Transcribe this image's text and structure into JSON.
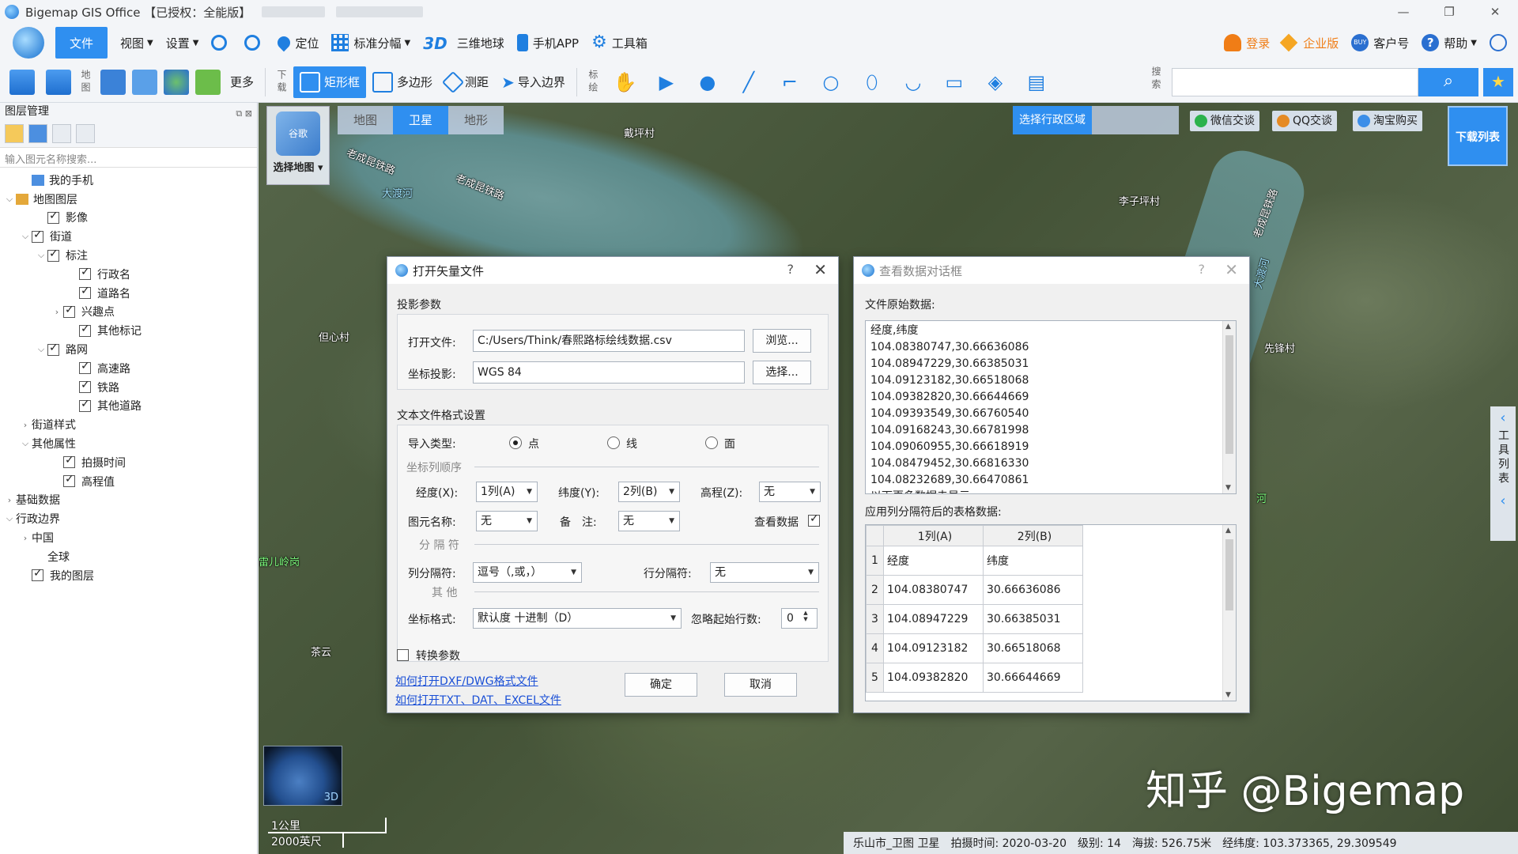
{
  "app": {
    "title": "Bigemap GIS Office 【已授权：全能版】",
    "window_controls": [
      "—",
      "❐",
      "✕"
    ]
  },
  "toolbar1": {
    "file": "文件",
    "view": "视图",
    "settings": "设置",
    "locate": "定位",
    "standard_sheet": "标准分幅",
    "earth3d_prefix": "3D",
    "earth3d": "三维地球",
    "mobile_app": "手机APP",
    "toolbox": "工具箱",
    "login": "登录",
    "enterprise": "企业版",
    "customer_no": "客户号",
    "help": "帮助"
  },
  "toolbar2": {
    "map_label": "地图",
    "more": "更多",
    "download_label": "下载",
    "rect": "矩形框",
    "polygon": "多边形",
    "measure": "测距",
    "import_boundary": "导入边界",
    "mark_label": "标绘",
    "search_label": "搜索",
    "search_value": ""
  },
  "layer_panel": {
    "title": "图层管理",
    "search_placeholder": "输入图元名称搜索...",
    "tree": [
      {
        "label": "我的手机",
        "indent": 1,
        "exp": "",
        "cb": "none",
        "icon": "phone"
      },
      {
        "label": "地图图层",
        "indent": 0,
        "exp": "⌵",
        "cb": "none",
        "icon": "layers"
      },
      {
        "label": "影像",
        "indent": 2,
        "exp": "",
        "cb": "checked"
      },
      {
        "label": "街道",
        "indent": 1,
        "exp": "⌵",
        "cb": "checked"
      },
      {
        "label": "标注",
        "indent": 2,
        "exp": "⌵",
        "cb": "checked"
      },
      {
        "label": "行政名",
        "indent": 4,
        "exp": "",
        "cb": "checked"
      },
      {
        "label": "道路名",
        "indent": 4,
        "exp": "",
        "cb": "checked"
      },
      {
        "label": "兴趣点",
        "indent": 3,
        "exp": "›",
        "cb": "checked"
      },
      {
        "label": "其他标记",
        "indent": 4,
        "exp": "",
        "cb": "checked"
      },
      {
        "label": "路网",
        "indent": 2,
        "exp": "⌵",
        "cb": "checked"
      },
      {
        "label": "高速路",
        "indent": 4,
        "exp": "",
        "cb": "checked"
      },
      {
        "label": "铁路",
        "indent": 4,
        "exp": "",
        "cb": "checked"
      },
      {
        "label": "其他道路",
        "indent": 4,
        "exp": "",
        "cb": "checked"
      },
      {
        "label": "街道样式",
        "indent": 1,
        "exp": "›",
        "cb": "none"
      },
      {
        "label": "其他属性",
        "indent": 1,
        "exp": "⌵",
        "cb": "none"
      },
      {
        "label": "拍摄时间",
        "indent": 3,
        "exp": "",
        "cb": "checked"
      },
      {
        "label": "高程值",
        "indent": 3,
        "exp": "",
        "cb": "checked"
      },
      {
        "label": "基础数据",
        "indent": 0,
        "exp": "›",
        "cb": "none"
      },
      {
        "label": "行政边界",
        "indent": 0,
        "exp": "⌵",
        "cb": "none"
      },
      {
        "label": "中国",
        "indent": 1,
        "exp": "›",
        "cb": "none"
      },
      {
        "label": "全球",
        "indent": 2,
        "exp": "",
        "cb": "none"
      },
      {
        "label": "我的图层",
        "indent": 1,
        "exp": "",
        "cb": "checked"
      }
    ]
  },
  "map": {
    "select_map": "选择地图",
    "select_map_thumb": "谷歌\n包",
    "tabs": [
      "地图",
      "卫星",
      "地形"
    ],
    "active_tab": "卫星",
    "select_region": "选择行政区域",
    "wechat": "微信交谈",
    "qq": "QQ交谈",
    "taobao": "淘宝购买",
    "download_list": "下载列表",
    "side_tools": "工具列表",
    "globe_3d": "3D",
    "scale_km": "1公里",
    "scale_ft": "2000英尺",
    "watermark": "知乎 @Bigemap",
    "labels": [
      {
        "text": "戴坪村",
        "cls": ""
      },
      {
        "text": "老成昆铁路",
        "cls": "rail"
      },
      {
        "text": "老成昆铁路",
        "cls": "rail"
      },
      {
        "text": "大渡河",
        "cls": "water"
      },
      {
        "text": "李子坪村",
        "cls": ""
      },
      {
        "text": "老成昆铁路",
        "cls": "rail"
      },
      {
        "text": "大渡河",
        "cls": "water"
      },
      {
        "text": "先锋村",
        "cls": ""
      },
      {
        "text": "但心村",
        "cls": ""
      },
      {
        "text": "茶云",
        "cls": ""
      },
      {
        "text": "雷儿岭岗",
        "cls": "green"
      },
      {
        "text": "河",
        "cls": "green"
      }
    ],
    "status": {
      "region": "乐山市_卫图 卫星",
      "shot_time": "拍摄时间: 2020-03-20",
      "level": "级别:  14",
      "altitude": "海拔: 526.75米",
      "lnglat": "经纬度:  103.373365, 29.309549"
    }
  },
  "open_dialog": {
    "title": "打开矢量文件",
    "help": "?",
    "close": "✕",
    "proj_group": "投影参数",
    "open_file_label": "打开文件:",
    "open_file_value": "C:/Users/Think/春熙路标绘线数据.csv",
    "browse": "浏览...",
    "coord_proj_label": "坐标投影:",
    "coord_proj_value": "WGS 84",
    "choose": "选择...",
    "text_group": "文本文件格式设置",
    "import_type_label": "导入类型:",
    "type_point": "点",
    "type_line": "线",
    "type_area": "面",
    "coord_order": "坐标列顺序",
    "lng_label": "经度(X):",
    "lng_value": "1列(A)",
    "lat_label": "纬度(Y):",
    "lat_value": "2列(B)",
    "alt_label": "高程(Z):",
    "alt_value": "无",
    "name_label": "图元名称:",
    "name_value": "无",
    "note_label": "备　注:",
    "note_value": "无",
    "view_data_label": "查看数据",
    "separator_head": "分 隔 符",
    "col_sep_label": "列分隔符:",
    "col_sep_value": "逗号（,或，）",
    "row_sep_label": "行分隔符:",
    "row_sep_value": "无",
    "other_head": "其 他",
    "coord_fmt_label": "坐标格式:",
    "coord_fmt_value": "默认度 十进制（D）",
    "skip_label": "忽略起始行数:",
    "skip_value": "0",
    "convert_label": "转换参数",
    "link_dxf": "如何打开DXF/DWG格式文件",
    "link_txt": "如何打开TXT、DAT、EXCEL文件",
    "ok": "确定",
    "cancel": "取消"
  },
  "view_dialog": {
    "title": "查看数据对话框",
    "help": "?",
    "close": "✕",
    "raw_label": "文件原始数据:",
    "raw_lines": [
      "经度,纬度",
      "104.08380747,30.66636086",
      "104.08947229,30.66385031",
      "104.09123182,30.66518068",
      "104.09382820,30.66644669",
      "104.09393549,30.66760540",
      "104.09168243,30.66781998",
      "104.09060955,30.66618919",
      "104.08479452,30.66816330",
      "104.08232689,30.66470861",
      "以下更多数据未显示..."
    ],
    "table_label": "应用列分隔符后的表格数据:",
    "columns": [
      "1列(A)",
      "2列(B)"
    ],
    "rows": [
      [
        "1",
        "经度",
        "纬度"
      ],
      [
        "2",
        "104.08380747",
        "30.66636086"
      ],
      [
        "3",
        "104.08947229",
        "30.66385031"
      ],
      [
        "4",
        "104.09123182",
        "30.66518068"
      ],
      [
        "5",
        "104.09382820",
        "30.66644669"
      ]
    ]
  }
}
